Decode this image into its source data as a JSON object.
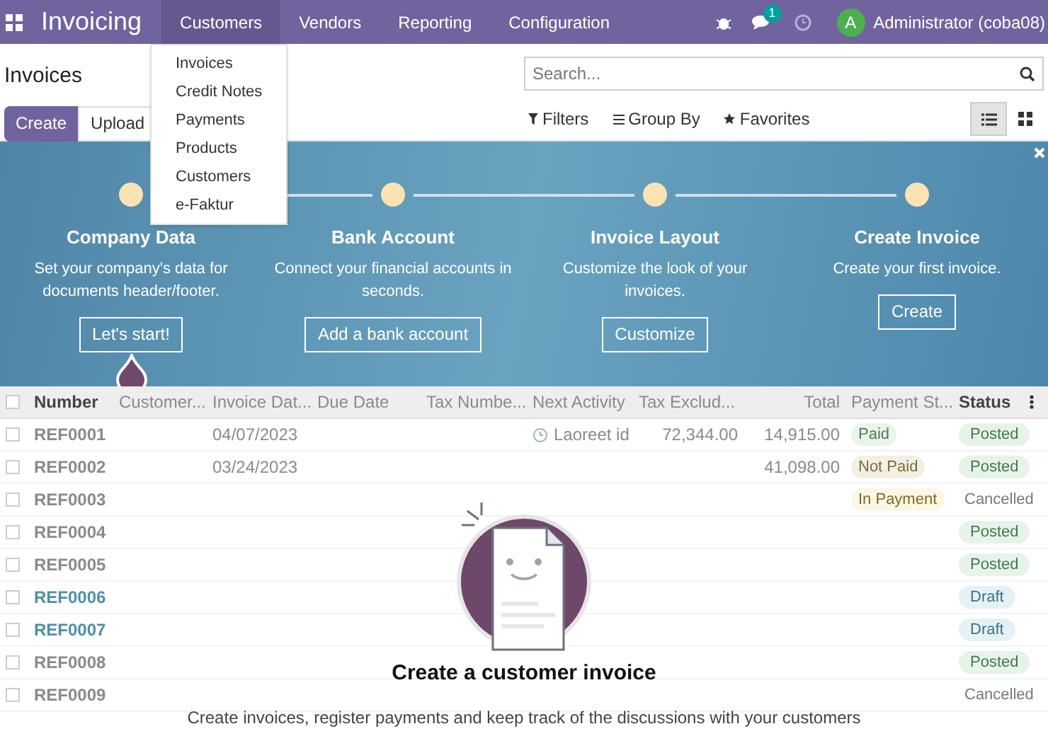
{
  "navbar": {
    "app_title": "Invoicing",
    "menus": [
      {
        "label": "Customers",
        "selected": true
      },
      {
        "label": "Vendors",
        "selected": false
      },
      {
        "label": "Reporting",
        "selected": false
      },
      {
        "label": "Configuration",
        "selected": false
      }
    ],
    "message_count": "1",
    "avatar_letter": "A",
    "user": "Administrator (coba08)"
  },
  "dropdown": {
    "items": [
      "Invoices",
      "Credit Notes",
      "Payments",
      "Products",
      "Customers",
      "e-Faktur"
    ]
  },
  "control_panel": {
    "title": "Invoices",
    "buttons": [
      {
        "label": "Create",
        "kind": "primary"
      },
      {
        "label": "Upload",
        "kind": "secondary"
      }
    ],
    "search": {
      "placeholder": "Search..."
    },
    "filters": [
      "Filters",
      "Group By",
      "Favorites"
    ],
    "views": [
      {
        "kind": "list",
        "selected": true
      },
      {
        "kind": "kanban",
        "selected": false
      }
    ]
  },
  "onboarding": {
    "steps": [
      {
        "title": "Company Data",
        "description": "Set your company's data for documents header/footer.",
        "button": "Let's start!",
        "current": true
      },
      {
        "title": "Bank Account",
        "description": "Connect your financial accounts in seconds.",
        "button": "Add a bank account",
        "current": false
      },
      {
        "title": "Invoice Layout",
        "description": "Customize the look of your invoices.",
        "button": "Customize",
        "current": false
      },
      {
        "title": "Create Invoice",
        "description": "Create your first invoice.",
        "button": "Create",
        "current": false
      }
    ]
  },
  "table": {
    "all_checked": false,
    "columns": [
      "Number",
      "Customer...",
      "Invoice Dat...",
      "Due Date",
      "Tax Numbe...",
      "Next Activity",
      "Tax Exclud...",
      "Total",
      "Payment St...",
      "Status"
    ],
    "rows": [
      {
        "checked": false,
        "number": "REF0001",
        "invoice_date": "04/07/2023",
        "next_activity": "Laoreet id",
        "tax_excluded": "72,344.00",
        "total": "14,915.00",
        "payment_status": {
          "label": "Paid",
          "kind": "paid"
        },
        "status": {
          "label": "Posted",
          "kind": "posted"
        }
      },
      {
        "checked": false,
        "number": "REF0002",
        "invoice_date": "03/24/2023",
        "total": "41,098.00",
        "payment_status": {
          "label": "Not Paid",
          "kind": "not_paid"
        },
        "status": {
          "label": "Posted",
          "kind": "posted"
        }
      },
      {
        "checked": false,
        "number": "REF0003",
        "payment_status": {
          "label": "In Payment",
          "kind": "in_payment"
        },
        "status": {
          "label": "Cancelled",
          "kind": "cancelled"
        }
      },
      {
        "checked": false,
        "number": "REF0004",
        "status": {
          "label": "Posted",
          "kind": "posted"
        }
      },
      {
        "checked": false,
        "number": "REF0005",
        "status": {
          "label": "Posted",
          "kind": "posted"
        }
      },
      {
        "checked": false,
        "number": "REF0006",
        "status": {
          "label": "Draft",
          "kind": "draft"
        }
      },
      {
        "checked": false,
        "number": "REF0007",
        "status": {
          "label": "Draft",
          "kind": "draft"
        }
      },
      {
        "checked": false,
        "number": "REF0008",
        "status": {
          "label": "Posted",
          "kind": "posted"
        }
      },
      {
        "checked": false,
        "number": "REF0009",
        "status": {
          "label": "Cancelled",
          "kind": "cancelled"
        }
      }
    ]
  },
  "empty_state": {
    "title": "Create a customer invoice",
    "text": "Create invoices, register payments and keep track of the discussions with your customers"
  }
}
